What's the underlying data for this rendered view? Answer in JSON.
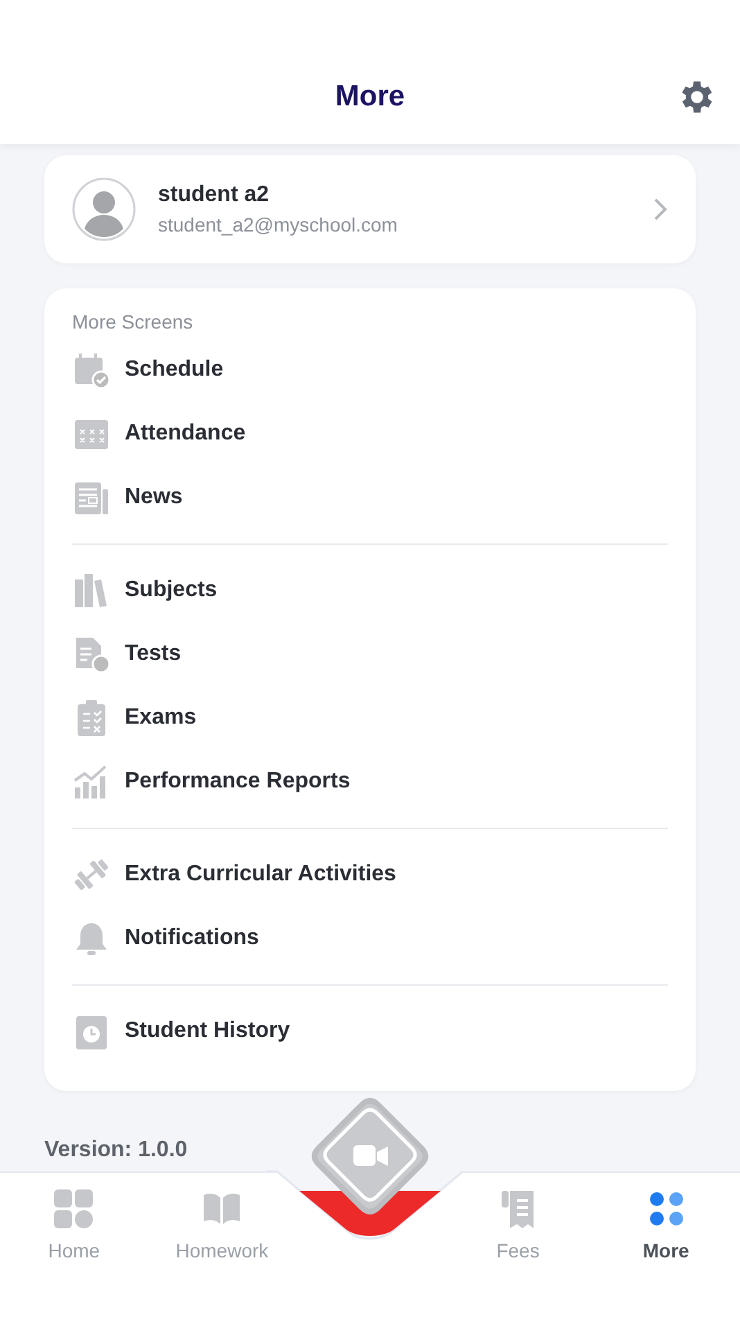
{
  "header": {
    "title": "More"
  },
  "profile": {
    "name": "student a2",
    "email": "student_a2@myschool.com"
  },
  "menu": {
    "title": "More Screens",
    "groups": [
      {
        "items": [
          {
            "label": "Schedule"
          },
          {
            "label": "Attendance"
          },
          {
            "label": "News"
          }
        ]
      },
      {
        "items": [
          {
            "label": "Subjects"
          },
          {
            "label": "Tests"
          },
          {
            "label": "Exams"
          },
          {
            "label": "Performance Reports"
          }
        ]
      },
      {
        "items": [
          {
            "label": "Extra Curricular Activities"
          },
          {
            "label": "Notifications"
          }
        ]
      },
      {
        "items": [
          {
            "label": "Student History"
          }
        ]
      }
    ]
  },
  "version": "Version: 1.0.0",
  "tabs": [
    {
      "kind": "tab",
      "label": "Home",
      "selected": false
    },
    {
      "kind": "tab",
      "label": "Homework",
      "selected": false
    },
    {
      "kind": "center"
    },
    {
      "kind": "tab",
      "label": "Fees",
      "selected": false
    },
    {
      "kind": "tab",
      "label": "More",
      "selected": true
    }
  ]
}
